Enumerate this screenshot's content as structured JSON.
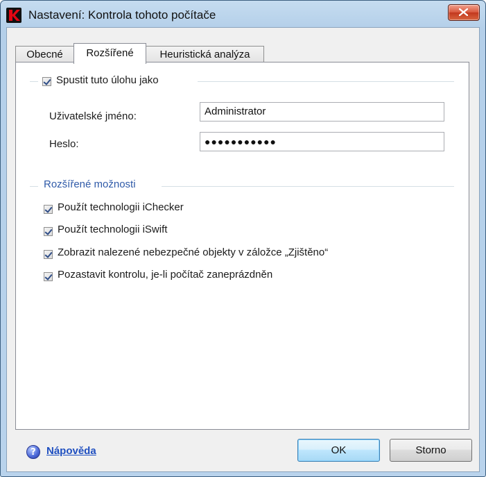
{
  "window": {
    "title": "Nastavení: Kontrola tohoto počítače"
  },
  "tabs": [
    {
      "label": "Obecné",
      "active": false
    },
    {
      "label": "Rozšířené",
      "active": true
    },
    {
      "label": "Heuristická analýza",
      "active": false
    }
  ],
  "run_as": {
    "label": "Spustit tuto úlohu jako",
    "checked": true,
    "username_label": "Uživatelské jméno:",
    "username_value": "Administrator",
    "password_label": "Heslo:",
    "password_value": "●●●●●●●●●●●"
  },
  "advanced": {
    "title": "Rozšířené možnosti",
    "options": [
      {
        "label": "Použít technologii iChecker",
        "checked": true
      },
      {
        "label": "Použít technologii iSwift",
        "checked": true
      },
      {
        "label": "Zobrazit nalezené nebezpečné objekty v záložce „Zjištěno“",
        "checked": true
      },
      {
        "label": "Pozastavit kontrolu, je-li počítač zaneprázdněn",
        "checked": true
      }
    ]
  },
  "footer": {
    "help_label": "Nápověda",
    "ok_label": "OK",
    "cancel_label": "Storno"
  },
  "icons": {
    "app": "kaspersky-k-icon",
    "close": "close-x-icon",
    "help": "help-question-icon"
  },
  "colors": {
    "accent": "#2f5aa8",
    "close_red": "#c2381e",
    "link": "#1f4fc0"
  }
}
